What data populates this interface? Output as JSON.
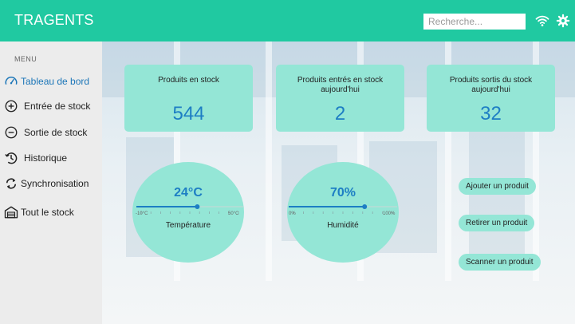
{
  "app": {
    "title": "TRAGENTS"
  },
  "search": {
    "placeholder": "Recherche..."
  },
  "header_icons": {
    "wifi": "wifi-icon",
    "settings": "gear-icon"
  },
  "sidebar": {
    "menu_title": "MENU",
    "items": [
      {
        "label": "Tableau de bord",
        "icon": "speedometer-icon",
        "active": true
      },
      {
        "label": "Entrée de stock",
        "icon": "plus-circle-icon",
        "active": false
      },
      {
        "label": "Sortie de stock",
        "icon": "minus-circle-icon",
        "active": false
      },
      {
        "label": "Historique",
        "icon": "history-icon",
        "active": false
      },
      {
        "label": "Synchronisation",
        "icon": "sync-icon",
        "active": false
      },
      {
        "label": "Tout le stock",
        "icon": "warehouse-icon",
        "active": false
      }
    ]
  },
  "stats": [
    {
      "title": "Produits en stock",
      "value": "544"
    },
    {
      "title": "Produits entrés en stock aujourd'hui",
      "value": "2"
    },
    {
      "title": "Produits sortis du stock aujourd'hui",
      "value": "32"
    }
  ],
  "gauges": {
    "temperature": {
      "value_text": "24°C",
      "label": "Température",
      "min_label": "-10°C",
      "max_label": "50°C",
      "level": 0.57
    },
    "humidity": {
      "value_text": "70%",
      "label": "Humidité",
      "min_label": "0%",
      "max_label": "100%",
      "level": 0.7
    }
  },
  "actions": {
    "add": "Ajouter un produit",
    "remove": "Retirer un produit",
    "scan": "Scanner un produit"
  },
  "colors": {
    "header": "#20c9a1",
    "card": "#94e6d6",
    "value": "#1d7ec4",
    "active_nav": "#1c76b8"
  }
}
